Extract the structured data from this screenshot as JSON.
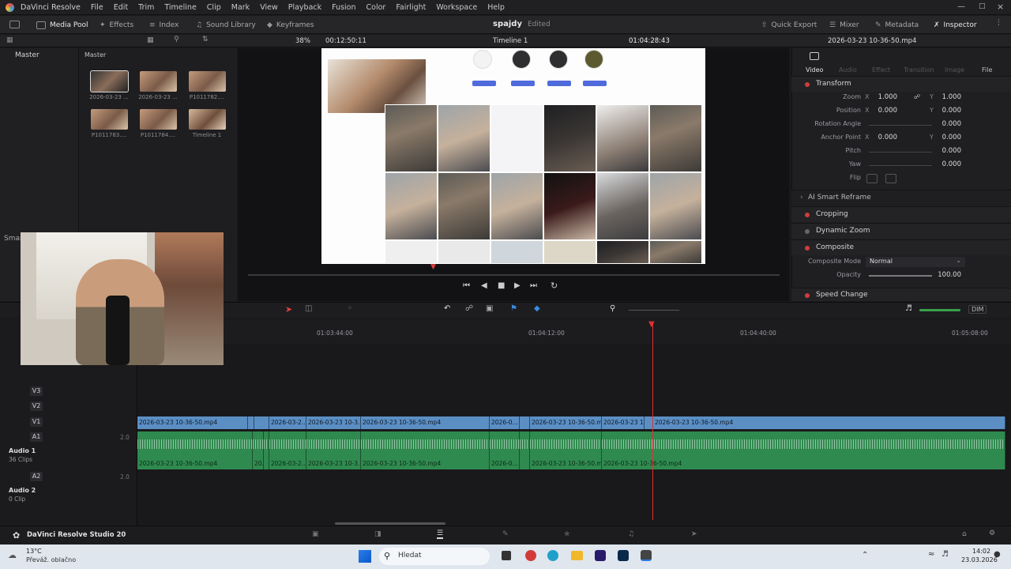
{
  "menubar": {
    "app_name": "DaVinci Resolve",
    "items": [
      "File",
      "Edit",
      "Trim",
      "Timeline",
      "Clip",
      "Mark",
      "View",
      "Playback",
      "Fusion",
      "Color",
      "Fairlight",
      "Workspace",
      "Help"
    ]
  },
  "toolbar": {
    "media_pool": "Media Pool",
    "effects": "Effects",
    "index": "Index",
    "sound_library": "Sound Library",
    "keyframes": "Keyframes",
    "project_name": "spajdy",
    "project_status": "Edited",
    "quick_export": "Quick Export",
    "mixer": "Mixer",
    "metadata": "Metadata",
    "inspector": "Inspector"
  },
  "subbar": {
    "zoom": "38%",
    "source_timecode": "00:12:50:11",
    "timeline_name": "Timeline 1",
    "timeline_timecode": "01:04:28:43",
    "clip_name": "2026-03-23 10-36-50.mp4"
  },
  "media_pool": {
    "bin_root": "Master",
    "bin_header": "Master",
    "smart_label": "Smar",
    "clips": [
      {
        "label": "2026-03-23 ..."
      },
      {
        "label": "2026-03-23 ..."
      },
      {
        "label": "P1011782...."
      },
      {
        "label": "P1011783...."
      },
      {
        "label": "P1011784...."
      },
      {
        "label": "Timeline 1"
      }
    ]
  },
  "inspector": {
    "tabs": [
      "Video",
      "Audio",
      "Effect",
      "Transition",
      "Image",
      "File"
    ],
    "transform": {
      "title": "Transform",
      "zoom": {
        "label": "Zoom",
        "x": "1.000",
        "y": "1.000"
      },
      "position": {
        "label": "Position",
        "x": "0.000",
        "y": "0.000"
      },
      "rotation": {
        "label": "Rotation Angle",
        "value": "0.000"
      },
      "anchor": {
        "label": "Anchor Point",
        "x": "0.000",
        "y": "0.000"
      },
      "pitch": {
        "label": "Pitch",
        "value": "0.000"
      },
      "yaw": {
        "label": "Yaw",
        "value": "0.000"
      },
      "flip": {
        "label": "Flip"
      }
    },
    "ai_smart_reframe": "AI Smart Reframe",
    "cropping": "Cropping",
    "dynamic_zoom": "Dynamic Zoom",
    "composite": {
      "title": "Composite",
      "mode_label": "Composite Mode",
      "mode_value": "Normal",
      "opacity_label": "Opacity",
      "opacity_value": "100.00"
    },
    "speed_change": "Speed Change"
  },
  "preview": {
    "buttons": [
      "Sledovat",
      "Sledovat",
      "Sledovat",
      "Sledovat"
    ]
  },
  "timeline": {
    "ruler": [
      "01:03:44:00",
      "01:04:12:00",
      "01:04:40:00",
      "01:05:08:00"
    ],
    "dim_label": "DIM",
    "tracks": {
      "v3": "V3",
      "v2": "V2",
      "v1": "V1",
      "a1": "A1",
      "a1_level": "2.0",
      "audio1_name": "Audio 1",
      "audio1_clips": "36 Clips",
      "a2": "A2",
      "a2_level": "2.0",
      "audio2_name": "Audio 2",
      "audio2_clips": "0 Clip"
    },
    "video_clips": [
      "2026-03-23 10-36-50.mp4",
      "",
      "",
      "2026-03-2...",
      "2026-03-23 10-3...",
      "2026-03-23 10-36-50.mp4",
      "2026-0...",
      "",
      "2026-03-23 10-36-50.m...",
      "2026-03-23 1...",
      "",
      "2026-03-23 10-36-50.mp4"
    ],
    "audio_clips": [
      "2026-03-23 10-36-50.mp4",
      "20...",
      "",
      "2026-03-2...",
      "2026-03-23 10-3...",
      "2026-03-23 10-36-50.mp4",
      "2026-0...",
      "",
      "2026-03-23 10-36-50.m...",
      "2026-03-23 10-36-50.mp4"
    ],
    "playhead_timecode": "01:04:28:43"
  },
  "footer": {
    "product": "DaVinci Resolve Studio 20"
  },
  "taskbar": {
    "weather_temp": "13°C",
    "weather_desc": "Převáž. oblačno",
    "search": "Hledat",
    "time": "14:02",
    "date": "23.03.2026"
  },
  "colors": {
    "video_clip": "#5b8fc4",
    "audio_clip": "#2f8a4f",
    "playhead": "#e03030",
    "accent_red": "#d23c3c"
  }
}
